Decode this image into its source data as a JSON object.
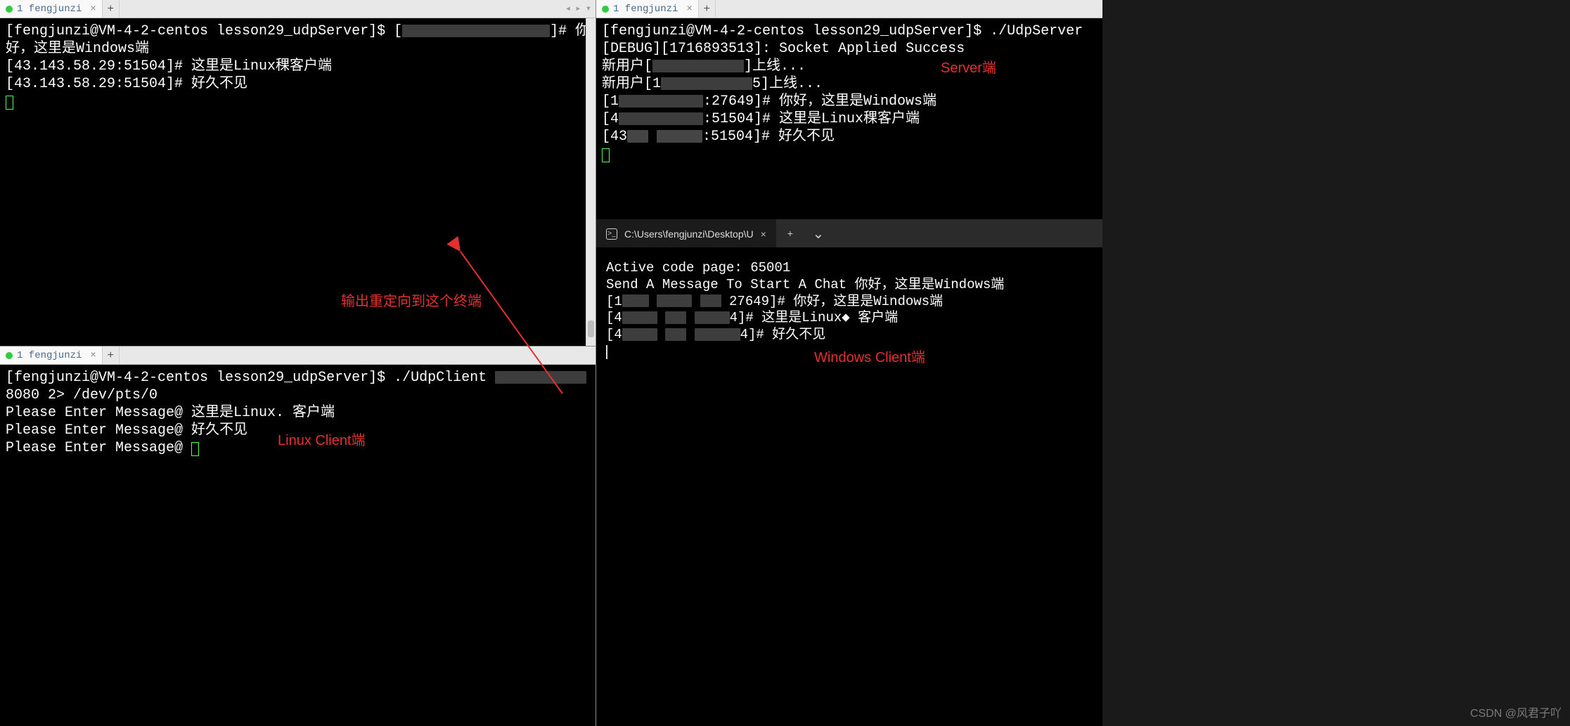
{
  "tabs": {
    "pane1": "1 fengjunzi",
    "pane2": "1 fengjunzi",
    "pane3": "1 fengjunzi",
    "pane4": "C:\\Users\\fengjunzi\\Desktop\\U"
  },
  "pane1": {
    "prompt": "[fengjunzi@VM-4-2-centos lesson29_udpServer]$ ",
    "line1_part_a": "[",
    "line1_part_b": "]# 你好，这里是Windows端",
    "line2": "[43.143.58.29:51504]# 这里是Linux稞客户端",
    "line3": "[43.143.58.29:51504]# 好久不见"
  },
  "pane2": {
    "cmd_a": "[fengjunzi@VM-4-2-centos lesson29_udpServer]$ ./UdpClient ",
    "cmd_b": " 8080 2> /dev/pts/0",
    "l1": "Please Enter Message@ 这里是Linux. 客户端",
    "l2": "Please Enter Message@ 好久不见",
    "l3": "Please Enter Message@ "
  },
  "pane3": {
    "cmd": "[fengjunzi@VM-4-2-centos lesson29_udpServer]$ ./UdpServer",
    "l1": "[DEBUG][1716893513]: Socket Applied Success",
    "l2a": "新用户[",
    "l2b": "]上线...",
    "l3a": "新用户[1",
    "l3b": "5]上线...",
    "l4a": "[1",
    "l4b": ":27649]# 你好，这里是Windows端",
    "l5a": "[4",
    "l5b": ":51504]# 这里是Linux稞客户端",
    "l6a": "[43",
    "l6b": ":51504]# 好久不见"
  },
  "pane4": {
    "l1": "Active code page: 65001",
    "l2": "Send A Message To Start A Chat 你好，这里是Windows端",
    "l3a": "[1",
    "l3b": "27649]# 你好，这里是Windows端",
    "l4a": "[4",
    "l4b": "4]# 这里是Linux◆ 客户端",
    "l5a": "[4",
    "l5b": "4]# 好久不见"
  },
  "annotations": {
    "redirect": "输出重定向到这个终端",
    "server": "Server端",
    "linux_client": "Linux Client端",
    "windows_client": "Windows Client端"
  },
  "watermark": "CSDN @风君子吖"
}
